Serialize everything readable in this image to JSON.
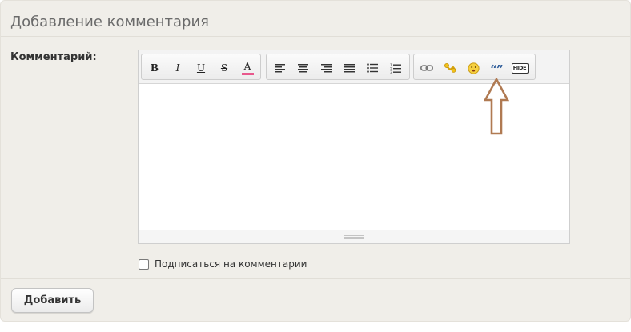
{
  "panel": {
    "title": "Добавление комментария",
    "comment_label": "Комментарий:",
    "subscribe_label": "Подписаться на комментарии",
    "subscribe_checked": false,
    "submit_label": "Добавить"
  },
  "toolbar": {
    "bold": "B",
    "italic": "I",
    "underline": "U",
    "strike": "S",
    "font_color": "A",
    "quote": "“”",
    "hide": "HIDE"
  },
  "colors": {
    "panel_bg": "#f0eee9",
    "font_color_underline": "#e8588c",
    "arrow": "#b07a52"
  },
  "icons": [
    "bold-icon",
    "italic-icon",
    "underline-icon",
    "strikethrough-icon",
    "font-color-icon",
    "align-left-icon",
    "align-center-icon",
    "align-right-icon",
    "align-justify-icon",
    "bullet-list-icon",
    "numbered-list-icon",
    "link-icon",
    "image-icon",
    "smiley-icon",
    "quote-icon",
    "hide-icon",
    "up-arrow-icon"
  ]
}
